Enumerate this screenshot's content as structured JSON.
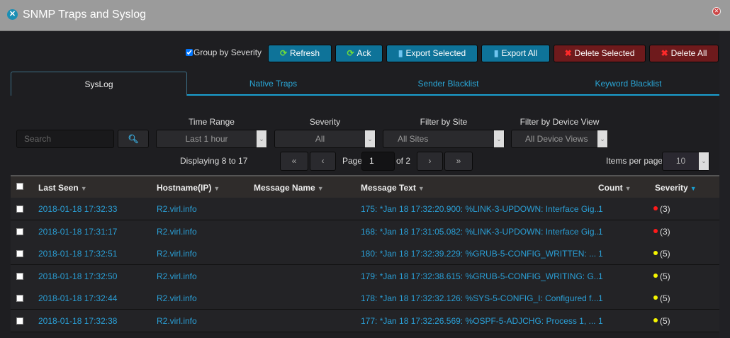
{
  "window": {
    "title": "SNMP Traps and Syslog"
  },
  "toolbar": {
    "group_by_severity": "Group by Severity",
    "group_checked": true,
    "refresh": "Refresh",
    "ack": "Ack",
    "export_selected": "Export Selected",
    "export_all": "Export All",
    "delete_selected": "Delete Selected",
    "delete_all": "Delete All"
  },
  "tabs": [
    {
      "label": "SysLog",
      "active": true
    },
    {
      "label": "Native Traps"
    },
    {
      "label": "Sender Blacklist"
    },
    {
      "label": "Keyword Blacklist"
    }
  ],
  "filters": {
    "search_placeholder": "Search",
    "time_range_label": "Time Range",
    "time_range": "Last 1 hour",
    "severity_label": "Severity",
    "severity": "All",
    "site_label": "Filter by Site",
    "site": "All Sites",
    "device_view_label": "Filter by Device View",
    "device_view": "All Device Views"
  },
  "pagination": {
    "displaying": "Displaying 8 to 17",
    "page_label": "Page",
    "page": "1",
    "of": "of 2",
    "items_per_page_label": "Items per page",
    "items_per_page": "10",
    "first": "«",
    "prev": "‹",
    "next": "›",
    "last": "»"
  },
  "table": {
    "columns": [
      "Last Seen",
      "Hostname(IP)",
      "Message Name",
      "Message Text",
      "Count",
      "Severity"
    ],
    "rows": [
      {
        "last_seen": "2018-01-18 17:32:33",
        "host": "R2.virl.info",
        "name": "",
        "text": "175: *Jan 18 17:32:20.900: %LINK-3-UPDOWN: Interface Gig...",
        "count": "1",
        "severity": "(3)",
        "color": "#ff1a1a"
      },
      {
        "last_seen": "2018-01-18 17:31:17",
        "host": "R2.virl.info",
        "name": "",
        "text": "168: *Jan 18 17:31:05.082: %LINK-3-UPDOWN: Interface Gig...",
        "count": "1",
        "severity": "(3)",
        "color": "#ff1a1a"
      },
      {
        "last_seen": "2018-01-18 17:32:51",
        "host": "R2.virl.info",
        "name": "",
        "text": "180: *Jan 18 17:32:39.229: %GRUB-5-CONFIG_WRITTEN: ...",
        "count": "1",
        "severity": "(5)",
        "color": "#f5f500"
      },
      {
        "last_seen": "2018-01-18 17:32:50",
        "host": "R2.virl.info",
        "name": "",
        "text": "179: *Jan 18 17:32:38.615: %GRUB-5-CONFIG_WRITING: G...",
        "count": "1",
        "severity": "(5)",
        "color": "#f5f500"
      },
      {
        "last_seen": "2018-01-18 17:32:44",
        "host": "R2.virl.info",
        "name": "",
        "text": "178: *Jan 18 17:32:32.126: %SYS-5-CONFIG_I: Configured f...",
        "count": "1",
        "severity": "(5)",
        "color": "#f5f500"
      },
      {
        "last_seen": "2018-01-18 17:32:38",
        "host": "R2.virl.info",
        "name": "",
        "text": "177: *Jan 18 17:32:26.569: %OSPF-5-ADJCHG: Process 1, ...",
        "count": "1",
        "severity": "(5)",
        "color": "#f5f500"
      }
    ]
  }
}
